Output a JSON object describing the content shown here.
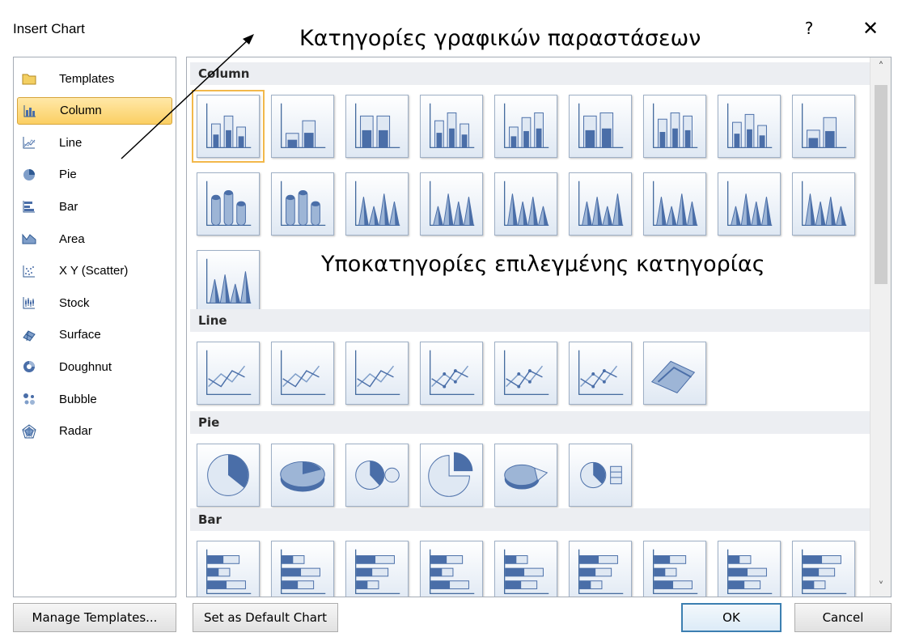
{
  "window": {
    "title": "Insert Chart",
    "help_glyph": "?",
    "close_glyph": "✕"
  },
  "annotations": {
    "categories_note": "Κατηγορίες γραφικών παραστάσεων",
    "subcategories_note": "Υποκατηγορίες επιλεγμένης κατηγορίας"
  },
  "sidebar": {
    "items": [
      {
        "label": "Templates",
        "icon": "folder-icon"
      },
      {
        "label": "Column",
        "icon": "column-chart-icon",
        "selected": true
      },
      {
        "label": "Line",
        "icon": "line-chart-icon"
      },
      {
        "label": "Pie",
        "icon": "pie-chart-icon"
      },
      {
        "label": "Bar",
        "icon": "bar-chart-icon"
      },
      {
        "label": "Area",
        "icon": "area-chart-icon"
      },
      {
        "label": "X Y (Scatter)",
        "icon": "scatter-chart-icon"
      },
      {
        "label": "Stock",
        "icon": "stock-chart-icon"
      },
      {
        "label": "Surface",
        "icon": "surface-chart-icon"
      },
      {
        "label": "Doughnut",
        "icon": "doughnut-chart-icon"
      },
      {
        "label": "Bubble",
        "icon": "bubble-chart-icon"
      },
      {
        "label": "Radar",
        "icon": "radar-chart-icon"
      }
    ]
  },
  "gallery": {
    "sections": [
      {
        "title": "Column",
        "count": 19,
        "kind": "column"
      },
      {
        "title": "Line",
        "count": 7,
        "kind": "line"
      },
      {
        "title": "Pie",
        "count": 6,
        "kind": "pie"
      },
      {
        "title": "Bar",
        "count": 9,
        "kind": "bar"
      }
    ],
    "selected": {
      "section": 0,
      "index": 0
    }
  },
  "scroll": {
    "up_glyph": "˄",
    "down_glyph": "˅"
  },
  "footer": {
    "manage_templates": "Manage Templates...",
    "set_default": "Set as Default Chart",
    "ok": "OK",
    "cancel": "Cancel"
  },
  "colors": {
    "selection": "#fbcf63",
    "accent": "#3c7fb1",
    "chart_fill": "#4a6ea8"
  }
}
